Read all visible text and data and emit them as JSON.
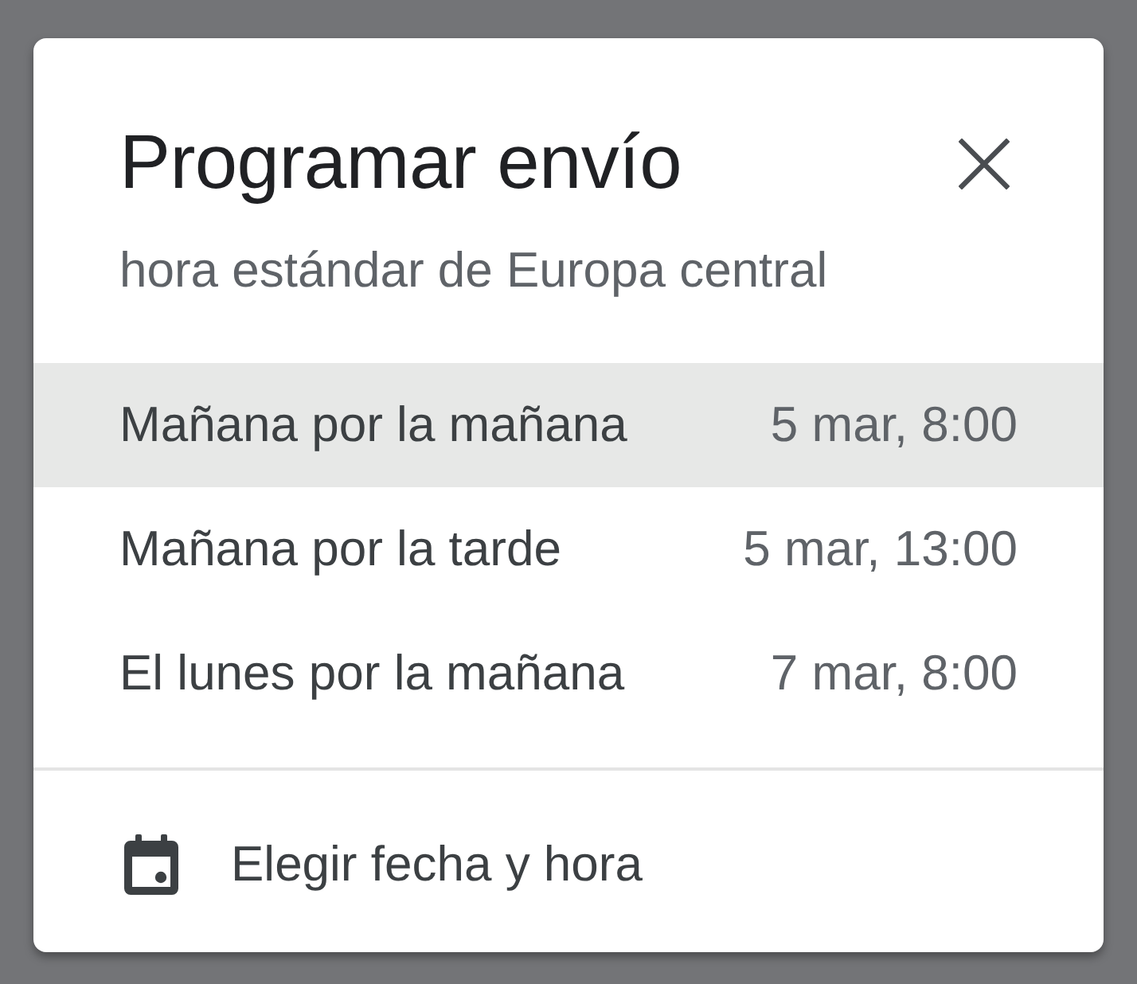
{
  "dialog": {
    "title": "Programar envío",
    "subtitle": "hora estándar de Europa central"
  },
  "options": [
    {
      "label": "Mañana por la mañana",
      "time": "5 mar, 8:00",
      "selected": true
    },
    {
      "label": "Mañana por la tarde",
      "time": "5 mar, 13:00",
      "selected": false
    },
    {
      "label": "El lunes por la mañana",
      "time": "7 mar, 8:00",
      "selected": false
    }
  ],
  "footer": {
    "label": "Elegir fecha y hora"
  }
}
